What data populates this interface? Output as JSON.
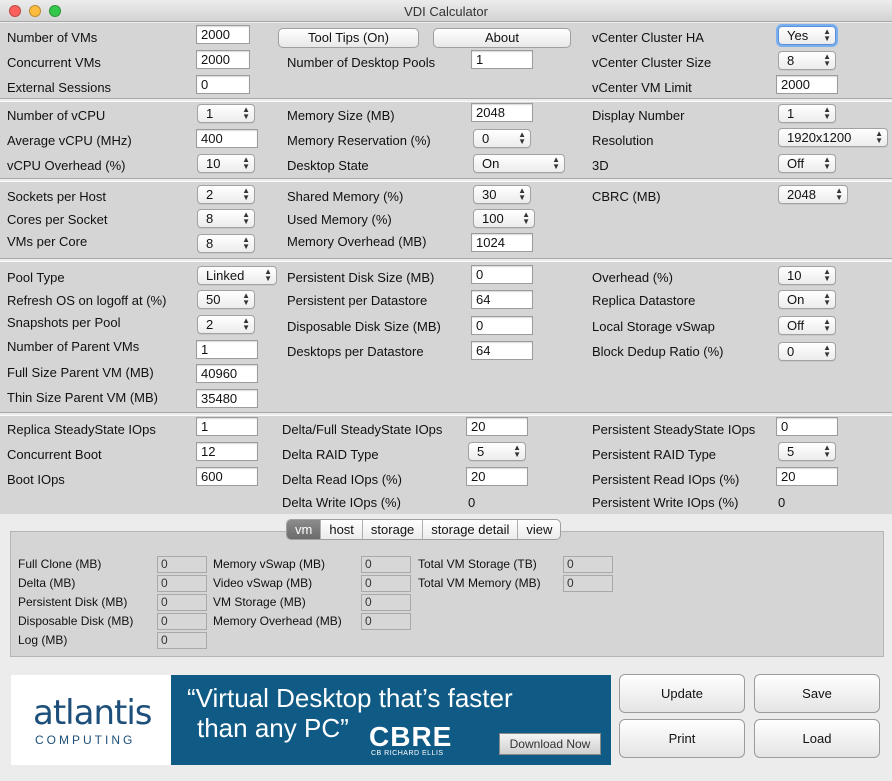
{
  "window": {
    "title": "VDI Calculator"
  },
  "top": {
    "num_vms_label": "Number of VMs",
    "num_vms": "2000",
    "concurrent_vms_label": "Concurrent VMs",
    "concurrent_vms": "2000",
    "external_sessions_label": "External Sessions",
    "external_sessions": "0",
    "tooltips_button": "Tool Tips (On)",
    "about_button": "About",
    "desktop_pools_label": "Number of Desktop Pools",
    "desktop_pools": "1",
    "cluster_ha_label": "vCenter Cluster HA",
    "cluster_ha": "Yes",
    "cluster_size_label": "vCenter Cluster Size",
    "cluster_size": "8",
    "vm_limit_label": "vCenter VM Limit",
    "vm_limit": "2000"
  },
  "cpu": {
    "num_vcpu_label": "Number of vCPU",
    "num_vcpu": "1",
    "avg_vcpu_label": "Average vCPU (MHz)",
    "avg_vcpu": "400",
    "vcpu_overhead_label": "vCPU Overhead (%)",
    "vcpu_overhead": "10",
    "memory_size_label": "Memory Size (MB)",
    "memory_size": "2048",
    "memory_reservation_label": "Memory Reservation (%)",
    "memory_reservation": "0",
    "desktop_state_label": "Desktop State",
    "desktop_state": "On",
    "display_number_label": "Display Number",
    "display_number": "1",
    "resolution_label": "Resolution",
    "resolution": "1920x1200",
    "threed_label": "3D",
    "threed": "Off"
  },
  "host": {
    "sockets_label": "Sockets per Host",
    "sockets": "2",
    "cores_label": "Cores per Socket",
    "cores": "8",
    "vms_per_core_label": "VMs per Core",
    "vms_per_core": "8",
    "shared_memory_label": "Shared Memory (%)",
    "shared_memory": "30",
    "used_memory_label": "Used Memory (%)",
    "used_memory": "100",
    "memory_overhead_label": "Memory Overhead (MB)",
    "memory_overhead": "1024",
    "cbrc_label": "CBRC (MB)",
    "cbrc": "2048"
  },
  "pool": {
    "pool_type_label": "Pool Type",
    "pool_type": "Linked",
    "refresh_label": "Refresh OS on logoff at (%)",
    "refresh": "50",
    "snapshots_label": "Snapshots per Pool",
    "snapshots": "2",
    "parent_vms_label": "Number of Parent VMs",
    "parent_vms": "1",
    "full_parent_label": "Full Size Parent VM (MB)",
    "full_parent": "40960",
    "thin_parent_label": "Thin Size Parent VM (MB)",
    "thin_parent": "35480",
    "persistent_disk_label": "Persistent Disk Size (MB)",
    "persistent_disk": "0",
    "persistent_per_ds_label": "Persistent per Datastore",
    "persistent_per_ds": "64",
    "disposable_disk_label": "Disposable Disk Size (MB)",
    "disposable_disk": "0",
    "desktops_per_ds_label": "Desktops per Datastore",
    "desktops_per_ds": "64",
    "overhead_label": "Overhead (%)",
    "overhead": "10",
    "replica_ds_label": "Replica Datastore",
    "replica_ds": "On",
    "local_vswap_label": "Local Storage vSwap",
    "local_vswap": "Off",
    "dedup_label": "Block Dedup Ratio (%)",
    "dedup": "0"
  },
  "iops": {
    "replica_steady_label": "Replica SteadyState IOps",
    "replica_steady": "1",
    "concurrent_boot_label": "Concurrent Boot",
    "concurrent_boot": "12",
    "boot_iops_label": "Boot IOps",
    "boot_iops": "600",
    "delta_steady_label": "Delta/Full SteadyState IOps",
    "delta_steady": "20",
    "delta_raid_label": "Delta RAID Type",
    "delta_raid": "5",
    "delta_read_label": "Delta Read IOps (%)",
    "delta_read": "20",
    "delta_write_label": "Delta Write IOps (%)",
    "delta_write": "0",
    "persistent_steady_label": "Persistent SteadyState IOps",
    "persistent_steady": "0",
    "persistent_raid_label": "Persistent RAID Type",
    "persistent_raid": "5",
    "persistent_read_label": "Persistent Read IOps (%)",
    "persistent_read": "20",
    "persistent_write_label": "Persistent Write IOps (%)",
    "persistent_write": "0"
  },
  "tabs": [
    "vm",
    "host",
    "storage",
    "storage detail",
    "view"
  ],
  "active_tab": "vm",
  "results": {
    "full_clone_label": "Full Clone (MB)",
    "full_clone": "0",
    "delta_label": "Delta (MB)",
    "delta": "0",
    "persistent_disk_label": "Persistent Disk (MB)",
    "persistent_disk": "0",
    "disposable_disk_label": "Disposable Disk (MB)",
    "disposable_disk": "0",
    "log_label": "Log (MB)",
    "log": "0",
    "memory_vswap_label": "Memory vSwap (MB)",
    "memory_vswap": "0",
    "video_vswap_label": "Video vSwap (MB)",
    "video_vswap": "0",
    "vm_storage_label": "VM Storage (MB)",
    "vm_storage": "0",
    "memory_overhead_label": "Memory Overhead (MB)",
    "memory_overhead": "0",
    "total_storage_label": "Total VM Storage (TB)",
    "total_storage": "0",
    "total_memory_label": "Total VM Memory (MB)",
    "total_memory": "0"
  },
  "ad": {
    "brand": "atlantis",
    "brand_sub": "COMPUTING",
    "quote_line1": "“Virtual Desktop that’s faster",
    "quote_line2": "than any PC”",
    "partner": "CBRE",
    "partner_sub": "CB RICHARD ELLIS",
    "cta": "Download Now"
  },
  "actions": {
    "update": "Update",
    "save": "Save",
    "print": "Print",
    "load": "Load"
  },
  "colors": {
    "panel_bg": "#d5d5d5",
    "window_bg": "#ececec",
    "ad_blue": "#0f5b86",
    "brand_blue": "#1d4f7a",
    "focus_ring": "#7ab0f0"
  }
}
